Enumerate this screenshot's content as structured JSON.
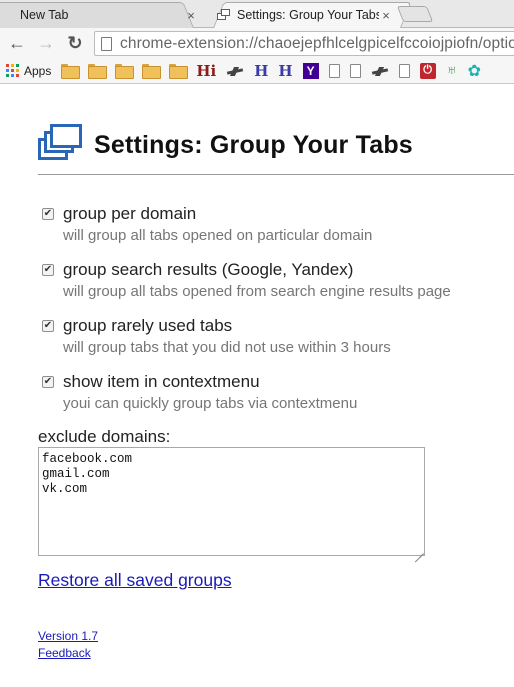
{
  "browser": {
    "tabs": [
      {
        "title": "New Tab",
        "close": "×"
      },
      {
        "title": "Settings: Group Your Tabs",
        "close": "×"
      }
    ],
    "toolbar": {
      "back": "←",
      "forward": "→",
      "reload": "↻"
    },
    "url": "chrome-extension://chaoejepfhlcelgpicelfccoiojpiofn/options.html",
    "bookmarks": {
      "apps_label": "Apps",
      "items": [
        {
          "icon": "folder-icon"
        },
        {
          "icon": "folder-icon"
        },
        {
          "icon": "folder-icon"
        },
        {
          "icon": "folder-icon"
        },
        {
          "icon": "folder-icon"
        },
        {
          "icon": "hi-logo-icon",
          "glyph": "Hi",
          "color": "#8b1a1a"
        },
        {
          "icon": "bird-icon"
        },
        {
          "icon": "h-logo-icon",
          "glyph": "H",
          "color": "#3a3aa8"
        },
        {
          "icon": "h-logo-icon",
          "glyph": "H",
          "color": "#3a3aa8"
        },
        {
          "icon": "y-logo-icon",
          "glyph": "Y",
          "color": "#410093"
        },
        {
          "icon": "page-icon"
        },
        {
          "icon": "page-icon"
        },
        {
          "icon": "bird-icon"
        },
        {
          "icon": "page-icon"
        },
        {
          "icon": "power-icon",
          "color": "#c0272d"
        },
        {
          "icon": "green-logo-icon",
          "color": "#3aa34a"
        },
        {
          "icon": "teal-logo-icon",
          "color": "#1bb3b3"
        }
      ]
    }
  },
  "page": {
    "title": "Settings: Group Your Tabs",
    "options": [
      {
        "label": "group per domain",
        "description": "will group all tabs opened on particular domain",
        "checked": true
      },
      {
        "label": "group search results (Google, Yandex)",
        "description": "will group all tabs opened from search engine results page",
        "checked": true
      },
      {
        "label": "group rarely used tabs",
        "description": "will group tabs that you did not use within 3 hours",
        "checked": true
      },
      {
        "label": "show item in contextmenu",
        "description": "youi can quickly group tabs via contextmenu",
        "checked": true
      }
    ],
    "exclude_label": "exclude domains:",
    "exclude_value": "facebook.com\ngmail.com\nvk.com",
    "restore_link": "Restore all saved groups",
    "version_link": "Version 1.7",
    "feedback_link": "Feedback",
    "accent_color": "#2a66b8",
    "link_color": "#1a1ab8"
  }
}
